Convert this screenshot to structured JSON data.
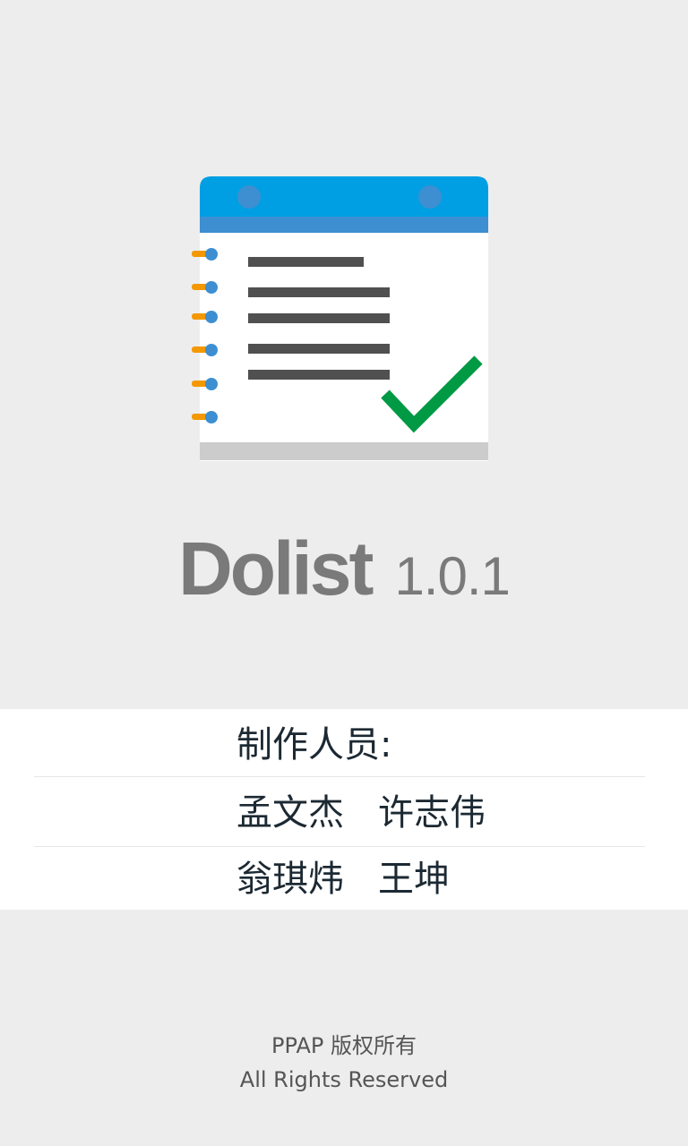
{
  "app": {
    "name": "Dolist",
    "version": "1.0.1"
  },
  "credits": {
    "heading": "制作人员:",
    "rows": [
      {
        "name1": "孟文杰",
        "name2": "许志伟"
      },
      {
        "name1": "翁琪炜",
        "name2": "王坤"
      }
    ]
  },
  "footer": {
    "copyright": "PPAP 版权所有",
    "rights": "All Rights Reserved"
  },
  "icons": {
    "logo": "todo-notepad-checkmark-icon"
  },
  "colors": {
    "background": "#ededed",
    "logo_header": "#009fe3",
    "logo_header_band": "#3d8fd1",
    "ring_pin": "#f39800",
    "checkmark": "#009944",
    "text_dark": "#1c2933",
    "title_gray": "#7a7a7a"
  }
}
